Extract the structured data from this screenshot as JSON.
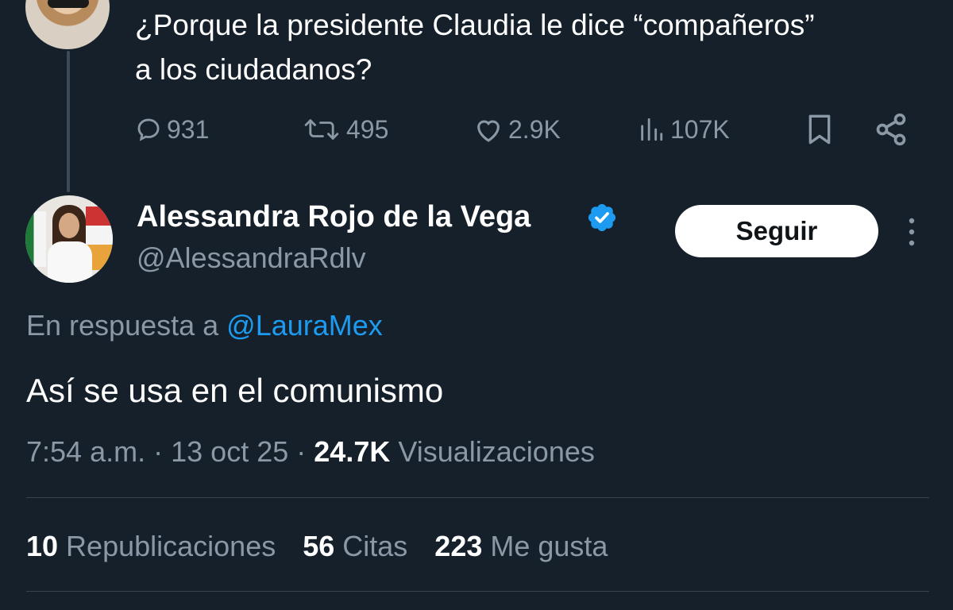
{
  "parent": {
    "text": "¿Porque la presidente Claudia le dice “compañeros” a los ciudadanos?",
    "actions": {
      "replies": "931",
      "retweets": "495",
      "likes": "2.9K",
      "views": "107K"
    }
  },
  "reply": {
    "author_name": "Alessandra Rojo de la Vega",
    "author_handle": "@AlessandraRdlv",
    "follow_label": "Seguir",
    "reply_to_prefix": "En respuesta a",
    "reply_to_mention": "@LauraMex",
    "text": "Así se usa en el comunismo",
    "time": "7:54 a.m.",
    "date": "13 oct 25",
    "views_count": "24.7K",
    "views_label": "Visualizaciones",
    "stats": {
      "reposts_count": "10",
      "reposts_label": "Republicaciones",
      "quotes_count": "56",
      "quotes_label": "Citas",
      "likes_count": "223",
      "likes_label": "Me gusta"
    }
  },
  "colors": {
    "background": "#15202b",
    "secondary_text": "#8b98a5",
    "accent": "#1d9bf0"
  }
}
